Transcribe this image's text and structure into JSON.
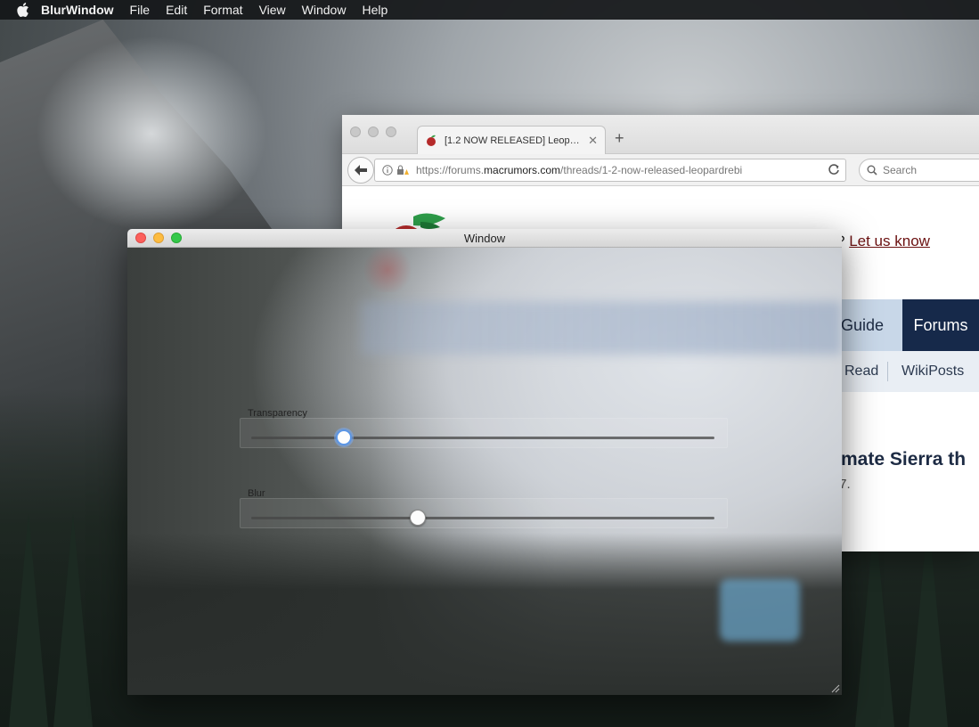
{
  "menubar": {
    "app_name": "BlurWindow",
    "items": [
      "File",
      "Edit",
      "Format",
      "View",
      "Window",
      "Help"
    ]
  },
  "browser": {
    "tab_title": "[1.2 NOW RELEASED] Leop…",
    "url_prefix": "https://forums.",
    "url_domain": "macrumors.com",
    "url_path": "/threads/1-2-now-released-leopardrebi",
    "search_placeholder": "Search",
    "let_us_prefix": "?",
    "let_us_link": "Let us know",
    "nav_guide": "Guide",
    "nav_forums": "Forums",
    "nav_read": "Read",
    "nav_wikiposts": "WikiPosts",
    "heading_fragment": "mate Sierra th",
    "sub_fragment": ".7."
  },
  "window": {
    "title": "Window",
    "transparency_label": "Transparency",
    "transparency_value": 0.2,
    "blur_label": "Blur",
    "blur_value": 0.36
  },
  "colors": {
    "close": "#fc605c",
    "minimize": "#fdbc40",
    "zoom": "#34c84a",
    "forums_nav": "#16294a",
    "link": "#6b1010",
    "slider_focus": "#5b96e6"
  }
}
